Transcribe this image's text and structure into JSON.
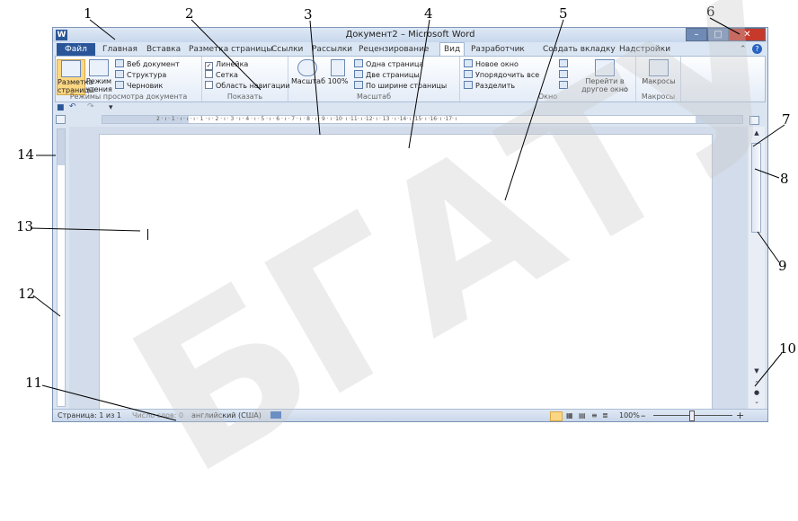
{
  "window": {
    "title": "Документ2 – Microsoft Word",
    "app_icon_letter": "W",
    "minimize": "–",
    "maximize": "□",
    "close": "✕"
  },
  "tabs": [
    "Файл",
    "Главная",
    "Вставка",
    "Разметка страницы",
    "Ссылки",
    "Рассылки",
    "Рецензирование",
    "Вид",
    "Разработчик",
    "Создать вкладку",
    "Надстройки"
  ],
  "ribbon": {
    "group_views": {
      "label": "Режимы просмотра документа",
      "page_layout": "Разметка страницы",
      "reading": "Режим чтения",
      "web": "Веб документ",
      "outline": "Структура",
      "draft": "Черновик"
    },
    "group_show": {
      "label": "Показать",
      "ruler": "Линейка",
      "grid": "Сетка",
      "nav_pane": "Область навигации"
    },
    "group_zoom": {
      "label": "Масштаб",
      "zoom": "Масштаб",
      "hundred": "100%",
      "one_page": "Одна страница",
      "two_pages": "Две страницы",
      "page_width": "По ширине страницы"
    },
    "group_window": {
      "label": "Окно",
      "new_window": "Новое окно",
      "arrange_all": "Упорядочить все",
      "split": "Разделить",
      "switch_windows": "Перейти в другое окно"
    },
    "group_macros": {
      "label": "Макросы",
      "macros": "Макросы"
    }
  },
  "qat": {
    "save": "■",
    "undo": "↶",
    "redo": "↷",
    "customize": "▾"
  },
  "ruler_text": "2 · ı · 1 · ı · ı · ı · 1 · ı · 2 · ı · 3 · ı · 4 · ı · 5 · ı · 6 · ı · 7 · ı · 8 · ı · 9 · ı ·10· ı ·11· ı ·12· ı · 13 · ı ·14· ı ·15· ı ·16· ı ·17· ı",
  "status": {
    "page": "Страница: 1 из 1",
    "words": "Число слов: 0",
    "language": "английский (США)",
    "zoom": "100%",
    "zoom_minus": "–",
    "zoom_plus": "+"
  },
  "callouts": [
    "1",
    "2",
    "3",
    "4",
    "5",
    "6",
    "7",
    "8",
    "9",
    "10",
    "11",
    "12",
    "13",
    "14"
  ],
  "watermark": "БГАТУ"
}
